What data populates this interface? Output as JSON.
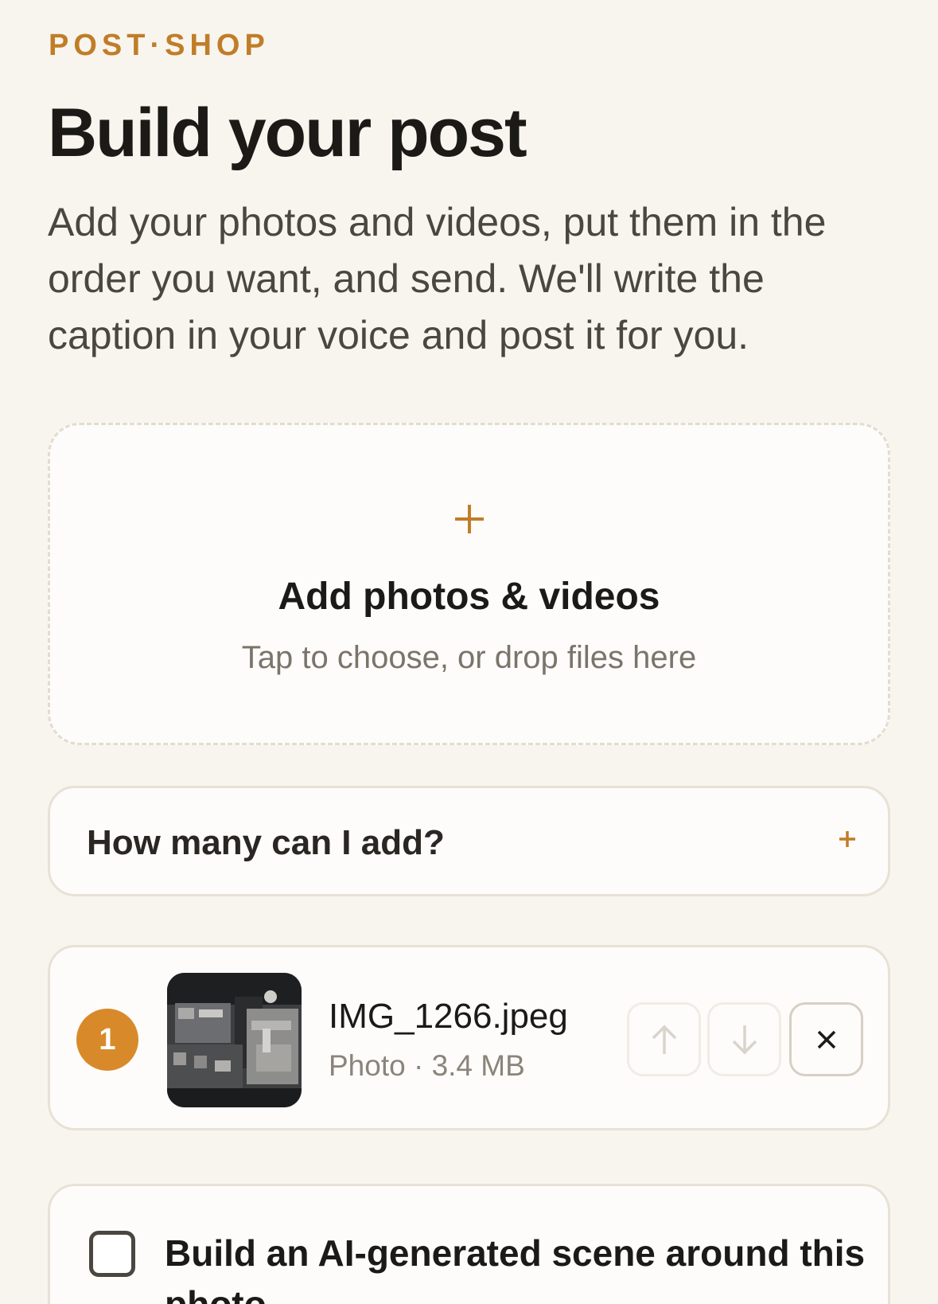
{
  "brand": "POST·SHOP",
  "header": {
    "title": "Build your post",
    "intro": "Add your photos and videos, put them in the order you want, and send. We'll write the caption in your voice and post it for you."
  },
  "dropzone": {
    "icon": "plus-icon",
    "title": "Add photos & videos",
    "subtitle": "Tap to choose, or drop files here"
  },
  "faq": {
    "question": "How many can I add?",
    "toggle_icon": "plus-icon"
  },
  "media_items": [
    {
      "order": "1",
      "thumbnail": "engine-photo",
      "file_name": "IMG_1266.jpeg",
      "meta": "Photo · 3.4 MB"
    }
  ],
  "option": {
    "label": "Build an AI-generated scene around this photo",
    "checked": false
  },
  "colors": {
    "accent": "#c07d28",
    "badge": "#d88a2b",
    "background": "#f8f5ef",
    "card": "#fdfcfa",
    "text": "#1c1a17"
  }
}
